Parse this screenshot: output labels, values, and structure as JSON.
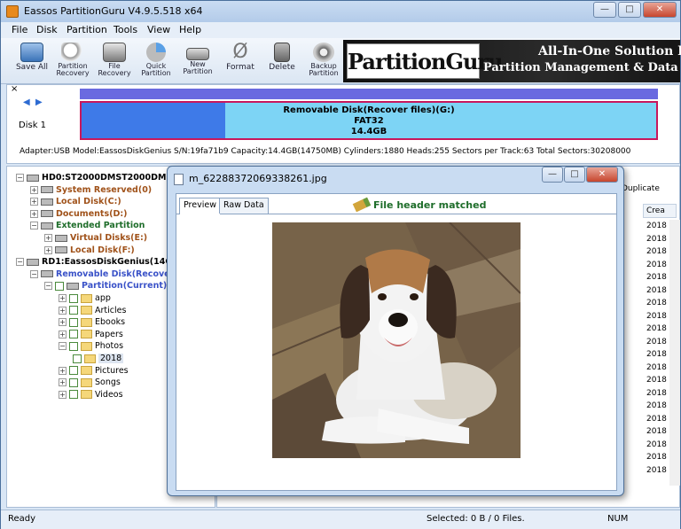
{
  "app": {
    "title": "Eassos PartitionGuru V4.9.5.518 x64"
  },
  "menu": [
    "File",
    "Disk",
    "Partition",
    "Tools",
    "View",
    "Help"
  ],
  "toolbar": [
    {
      "label": "Save All",
      "icon": "save-disk-icon"
    },
    {
      "label": "Partition Recovery",
      "icon": "magnifier-icon"
    },
    {
      "label": "File Recovery",
      "icon": "file-recovery-icon"
    },
    {
      "label": "Quick Partition",
      "icon": "quick-partition-icon"
    },
    {
      "label": "New Partition",
      "icon": "new-partition-icon"
    },
    {
      "label": "Format",
      "icon": "format-icon"
    },
    {
      "label": "Delete",
      "icon": "trash-icon"
    },
    {
      "label": "Backup Partition",
      "icon": "backup-icon"
    }
  ],
  "banner": {
    "logo": "PartitionGuru",
    "tagline1": "All-In-One Solution For",
    "tagline2": "Partition Management & Data Re"
  },
  "disk": {
    "label": "Disk  1",
    "partition_name": "Removable Disk(Recover files)(G:)",
    "fs": "FAT32",
    "size": "14.4GB",
    "info": "Adapter:USB  Model:EassosDiskGenius  S/N:19fa71b9  Capacity:14.4GB(14750MB)  Cylinders:1880  Heads:255  Sectors per Track:63  Total Sectors:30208000"
  },
  "tree": [
    {
      "text": "HD0:ST2000DMST2000DM001",
      "level": 0
    },
    {
      "text": "System Reserved(0)",
      "level": 1
    },
    {
      "text": "Local Disk(C:)",
      "level": 1
    },
    {
      "text": "Documents(D:)",
      "level": 1
    },
    {
      "text": "Extended Partition",
      "level": 1
    },
    {
      "text": "Virtual Disks(E:)",
      "level": 2
    },
    {
      "text": "Local Disk(F:)",
      "level": 2
    },
    {
      "text": "RD1:EassosDiskGenius(14GB)",
      "level": 0
    },
    {
      "text": "Removable Disk(Recover",
      "level": 1
    },
    {
      "text": "Partition(Current)(G",
      "level": 2
    },
    {
      "text": "app",
      "level": 3
    },
    {
      "text": "Articles",
      "level": 3
    },
    {
      "text": "Ebooks",
      "level": 3
    },
    {
      "text": "Papers",
      "level": 3
    },
    {
      "text": "Photos",
      "level": 3
    },
    {
      "text": "2018",
      "level": 4
    },
    {
      "text": "Pictures",
      "level": 3
    },
    {
      "text": "Songs",
      "level": 3
    },
    {
      "text": "Videos",
      "level": 3
    }
  ],
  "filelist": {
    "duplicate_label": "Duplicate",
    "column_header": "Crea",
    "dates": [
      "2018",
      "2018",
      "2018",
      "2018",
      "2018",
      "2018",
      "2018",
      "2018",
      "2018",
      "2018",
      "2018",
      "2018",
      "2018",
      "2018",
      "2018",
      "2018",
      "2018",
      "2018",
      "2018",
      "2018"
    ]
  },
  "dialog": {
    "title": "m_62288372069338261.jpg",
    "tabs": [
      "Preview",
      "Raw Data"
    ],
    "status": "File header matched"
  },
  "status": {
    "ready": "Ready",
    "selected": "Selected: 0 B / 0 Files.",
    "num": "NUM"
  }
}
